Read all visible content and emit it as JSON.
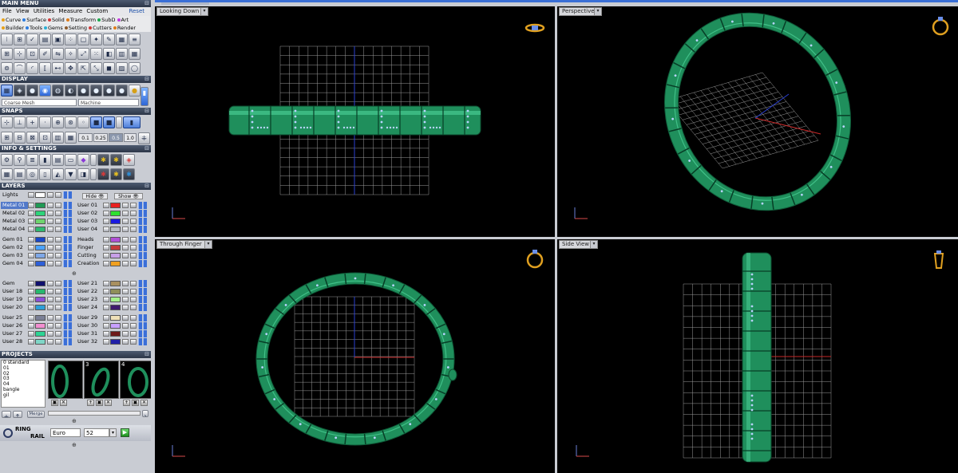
{
  "main_menu": {
    "title": "MAIN MENU",
    "menus": [
      "File",
      "View",
      "Utilities",
      "Measure",
      "Custom"
    ],
    "reset_label": "Reset",
    "categories_row1": [
      {
        "label": "Curve",
        "color": "#e8a21a"
      },
      {
        "label": "Surface",
        "color": "#2d7de0"
      },
      {
        "label": "Solid",
        "color": "#d43b3b"
      },
      {
        "label": "Transform",
        "color": "#e07d1a"
      },
      {
        "label": "SubD",
        "color": "#1aa84c"
      },
      {
        "label": "Art",
        "color": "#c43be0"
      }
    ],
    "categories_row2": [
      {
        "label": "Builder",
        "color": "#e8a21a"
      },
      {
        "label": "Tools",
        "color": "#2d7de0"
      },
      {
        "label": "Gems",
        "color": "#2ab0d6"
      },
      {
        "label": "Setting",
        "color": "#8b5a2b"
      },
      {
        "label": "Cutters",
        "color": "#d43b3b"
      },
      {
        "label": "Render",
        "color": "#e07d1a"
      }
    ]
  },
  "display": {
    "title": "DISPLAY",
    "mesh_mode": "Coarse Mesh",
    "material": "Machine"
  },
  "snaps": {
    "title": "SNAPS",
    "values": [
      "0.1",
      "0.25",
      "0.5",
      "1.0"
    ]
  },
  "info_settings": {
    "title": "INFO & SETTINGS"
  },
  "layers": {
    "title": "LAYERS",
    "hide_label": "Hide",
    "show_label": "Show",
    "left_col": [
      {
        "name": "Lights",
        "color": "#ffffff"
      },
      {
        "name": "Metal 01",
        "color": "#1f9a55",
        "selected": true
      },
      {
        "name": "Metal 02",
        "color": "#2dd47a"
      },
      {
        "name": "Metal 03",
        "color": "#6ed46e"
      },
      {
        "name": "Metal 04",
        "color": "#2fb870"
      },
      {
        "name": "Gem 01",
        "color": "#1847c7"
      },
      {
        "name": "Gem 02",
        "color": "#4aa3ff"
      },
      {
        "name": "Gem 03",
        "color": "#7fa8e8"
      },
      {
        "name": "Gem 04",
        "color": "#2d5fd8"
      },
      {
        "name": "Gem",
        "color": "#10106e"
      },
      {
        "name": "User 18",
        "color": "#27b86e"
      },
      {
        "name": "User 19",
        "color": "#8a4fd6"
      },
      {
        "name": "User 20",
        "color": "#2d9fd8"
      },
      {
        "name": "User 25",
        "color": "#7a7f96"
      },
      {
        "name": "User 26",
        "color": "#f28fd0"
      },
      {
        "name": "User 27",
        "color": "#2dd494"
      },
      {
        "name": "User 28",
        "color": "#7fd6c7"
      }
    ],
    "right_col": [
      {
        "name": "User 01",
        "color": "#e82020"
      },
      {
        "name": "User 02",
        "color": "#2ee02e"
      },
      {
        "name": "User 03",
        "color": "#1a1ae0"
      },
      {
        "name": "User 04",
        "color": "#b8bcc4"
      },
      {
        "name": "Heads",
        "color": "#b04fd6"
      },
      {
        "name": "Finger",
        "color": "#c43a3a"
      },
      {
        "name": "Cutting",
        "color": "#c7a0e8"
      },
      {
        "name": "Creation",
        "color": "#f0a020"
      },
      {
        "name": "User 21",
        "color": "#a89060"
      },
      {
        "name": "User 22",
        "color": "#8f8f5a"
      },
      {
        "name": "User 23",
        "color": "#a4f08a"
      },
      {
        "name": "User 24",
        "color": "#401a6e"
      },
      {
        "name": "User 29",
        "color": "#efe0b8"
      },
      {
        "name": "User 30",
        "color": "#c7a0ff"
      },
      {
        "name": "User 31",
        "color": "#6e1a1a"
      },
      {
        "name": "User 32",
        "color": "#2020a8"
      }
    ]
  },
  "projects": {
    "title": "PROJECTS",
    "items": [
      "0 standard",
      "01",
      "02",
      "03",
      "04",
      "bangle",
      "gil"
    ],
    "thumb_numbers": [
      "3",
      "4"
    ],
    "merge_label": "Merge"
  },
  "ring_rail": {
    "label_top": "RING",
    "label_bottom": "RAIL",
    "size_system": "Euro",
    "size_value": "52"
  },
  "viewports": [
    {
      "label": "Looking Down"
    },
    {
      "label": "Perspective"
    },
    {
      "label": "Through Finger"
    },
    {
      "label": "Side View"
    }
  ],
  "colors": {
    "metal": "#1f8f5c",
    "metal_light": "#4fd49a",
    "gem": "#b8d4ff",
    "grid": "#9a9a9a",
    "axis_red": "#c62828",
    "axis_blue": "#2a3fd0",
    "ring_icon": "#e0a020"
  }
}
